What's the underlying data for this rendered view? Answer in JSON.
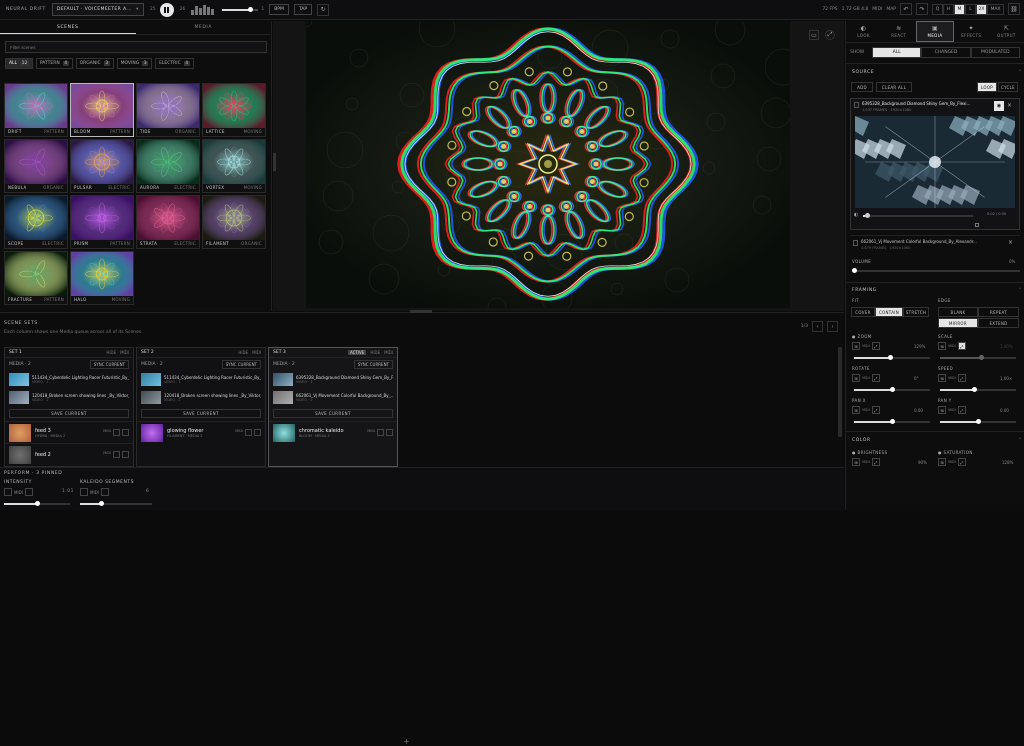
{
  "topbar": {
    "brand": "NEURAL DRIFT",
    "preset": "DEFAULT · VOICEMEETER A...",
    "prev_label": "25",
    "next_label": "26",
    "meter_levels": [
      0.5,
      0.9,
      0.7,
      1.0,
      0.8,
      0.6
    ],
    "volume_level": 0.78,
    "volume_end_label": "1",
    "buttons": [
      "BPM",
      "TAP"
    ],
    "stats": "72 FPS",
    "resolution": "1.72 GB 4.8",
    "midi_label": "MIDI",
    "map_label": "MAP",
    "quality": [
      "Q",
      "H",
      "M",
      "L",
      "2X",
      "MAX"
    ],
    "quality_selected": 2,
    "quality_selected_2": 4
  },
  "left": {
    "tabs": [
      "SCENES",
      "MEDIA"
    ],
    "active_tab": 0,
    "filter_placeholder": "Filter scenes",
    "categories": [
      {
        "label": "ALL",
        "count": "12"
      },
      {
        "label": "PATTERN",
        "count": "4"
      },
      {
        "label": "ORGANIC",
        "count": "3"
      },
      {
        "label": "MOVING",
        "count": "3"
      },
      {
        "label": "ELECTRIC",
        "count": "4"
      }
    ],
    "tiles": [
      {
        "name": "DRIFT",
        "cat": "PATTERN"
      },
      {
        "name": "BLOOM",
        "cat": "PATTERN"
      },
      {
        "name": "TIDE",
        "cat": "ORGANIC"
      },
      {
        "name": "LATTICE",
        "cat": "MOVING"
      },
      {
        "name": "NEBULA",
        "cat": "ORGANIC"
      },
      {
        "name": "PULSAR",
        "cat": "ELECTRIC"
      },
      {
        "name": "AURORA",
        "cat": "ELECTRIC"
      },
      {
        "name": "VORTEX",
        "cat": "MOVING"
      },
      {
        "name": "SCOPE",
        "cat": "ELECTRIC"
      },
      {
        "name": "PRISM",
        "cat": "PATTERN"
      },
      {
        "name": "STRATA",
        "cat": "ELECTRIC"
      },
      {
        "name": "FILAMENT",
        "cat": "ORGANIC"
      },
      {
        "name": "FRACTURE",
        "cat": "PATTERN"
      },
      {
        "name": "HALO",
        "cat": "MOVING"
      }
    ]
  },
  "scenes": {
    "title": "SCENE SETS",
    "subtitle": "Each column shows one Media queue across all of its Scenes.",
    "page": "1/3",
    "sets": [
      {
        "name": "SET 1",
        "media_label": "MEDIA · 2",
        "sync": "SYNC CURRENT",
        "items": [
          {
            "name": "511434_Cyberdelic Lighting Racer Futuristic_By_...",
            "sub": "VIDEO · 1"
          },
          {
            "name": "120418_Broken screen showing lines _By_Viktor_...",
            "sub": "VIDEO · 2"
          }
        ],
        "save": "SAVE CURRENT",
        "scenes": [
          {
            "name": "feed 3",
            "sub": "HYDRA · MEDIA 2"
          },
          {
            "name": "feed 2",
            "sub": ""
          }
        ]
      },
      {
        "name": "SET 2",
        "media_label": "MEDIA · 2",
        "sync": "SYNC CURRENT",
        "items": [
          {
            "name": "511434_Cyberdelic Lighting Racer Futuristic_By_...",
            "sub": "VIDEO · 1"
          },
          {
            "name": "120418_Broken screen showing lines _By_Viktor_...",
            "sub": "VIDEO · 2"
          }
        ],
        "save": "SAVE CURRENT",
        "scenes": [
          {
            "name": "glowing flower",
            "sub": "FILAMENT · MEDIA 2"
          }
        ]
      },
      {
        "name": "SET 3",
        "live": "ACTIVE",
        "media_label": "MEDIA · 2",
        "sync": "SYNC CURRENT",
        "items": [
          {
            "name": "6395328_Background Diamond Shiny Gem_By_F...",
            "sub": "VIDEO · 1"
          },
          {
            "name": "662061_Vj Movement Colorful Background_By_...",
            "sub": "VIDEO · 2"
          }
        ],
        "save": "SAVE CURRENT",
        "scenes": [
          {
            "name": "chromatic kaleido",
            "sub": "BLOOM · MEDIA 2"
          }
        ]
      }
    ],
    "set_controls": [
      "HIDE",
      "MIDI"
    ],
    "scene_ctl": "MIDI"
  },
  "perform": {
    "title": "PERFORM · 3 PINNED",
    "intensity_label": "INTENSITY",
    "intensity_value": "1.01",
    "intensity_level": 0.5,
    "kaleido_label": "KALEIDO SEGMENTS",
    "kaleido_value": "6",
    "kaleido_level": 0.3,
    "ctl_text": "MIDI"
  },
  "right": {
    "tabs": [
      {
        "label": "LOOK",
        "glyph": "◐"
      },
      {
        "label": "REACT",
        "glyph": "≋"
      },
      {
        "label": "MEDIA",
        "glyph": "▣"
      },
      {
        "label": "EFFECTS",
        "glyph": "✦"
      },
      {
        "label": "OUTPUT",
        "glyph": "⇱"
      }
    ],
    "active_tab": 2,
    "show_label": "SHOW",
    "show_options": [
      "ALL",
      "CHANGED",
      "MODULATED"
    ],
    "show_selected": 0,
    "source_title": "SOURCE",
    "source_buttons": [
      "ADD",
      "CLEAR ALL"
    ],
    "mode_buttons": [
      "LOOP",
      "CYCLE"
    ],
    "mode_selected": 0,
    "media1_name": "6395328_Background Diamond Shiny Gem_By_Flexi...",
    "media1_sub": "1,537 FRAMES · 1920×1080",
    "media_time": "0:02 / 0:30",
    "media_progress": 0.04,
    "media2_name": "662061_Vj Movement Colorful Background_By_Alexandr...",
    "media2_sub": "4,679 FRAMES · 1920×1080",
    "volume_label": "VOLUME",
    "volume_value": "0%",
    "volume_level": 0.0,
    "framing_title": "FRAMING",
    "fit_label": "FIT",
    "fit_options": [
      "COVER",
      "CONTAIN",
      "STRETCH"
    ],
    "fit_selected": 1,
    "edge_label": "EDGE",
    "edge_options": [
      "BLANK",
      "REPEAT",
      "MIRROR",
      "EXTEND"
    ],
    "edge_selected": 2,
    "zoom_label": "● ZOOM",
    "zoom_value": "129%",
    "zoom_level": 0.48,
    "scale_label": "SCALE",
    "scale_value": "1.00%",
    "scale_level": 0.55,
    "rotate_label": "ROTATE",
    "rotate_value": "0°",
    "rotate_level": 0.5,
    "speed_label": "SPEED",
    "speed_value": "1.00×",
    "speed_level": 0.45,
    "panx_label": "PAN X",
    "panx_value": "0.00",
    "panx_level": 0.5,
    "pany_label": "PAN Y",
    "pany_value": "0.00",
    "pany_level": 0.5,
    "color_title": "COLOR",
    "brightness_label": "● BRIGHTNESS",
    "brightness_value": "90%",
    "saturation_label": "● SATURATION",
    "saturation_value": "128%",
    "ctl_text": "MIDI"
  }
}
